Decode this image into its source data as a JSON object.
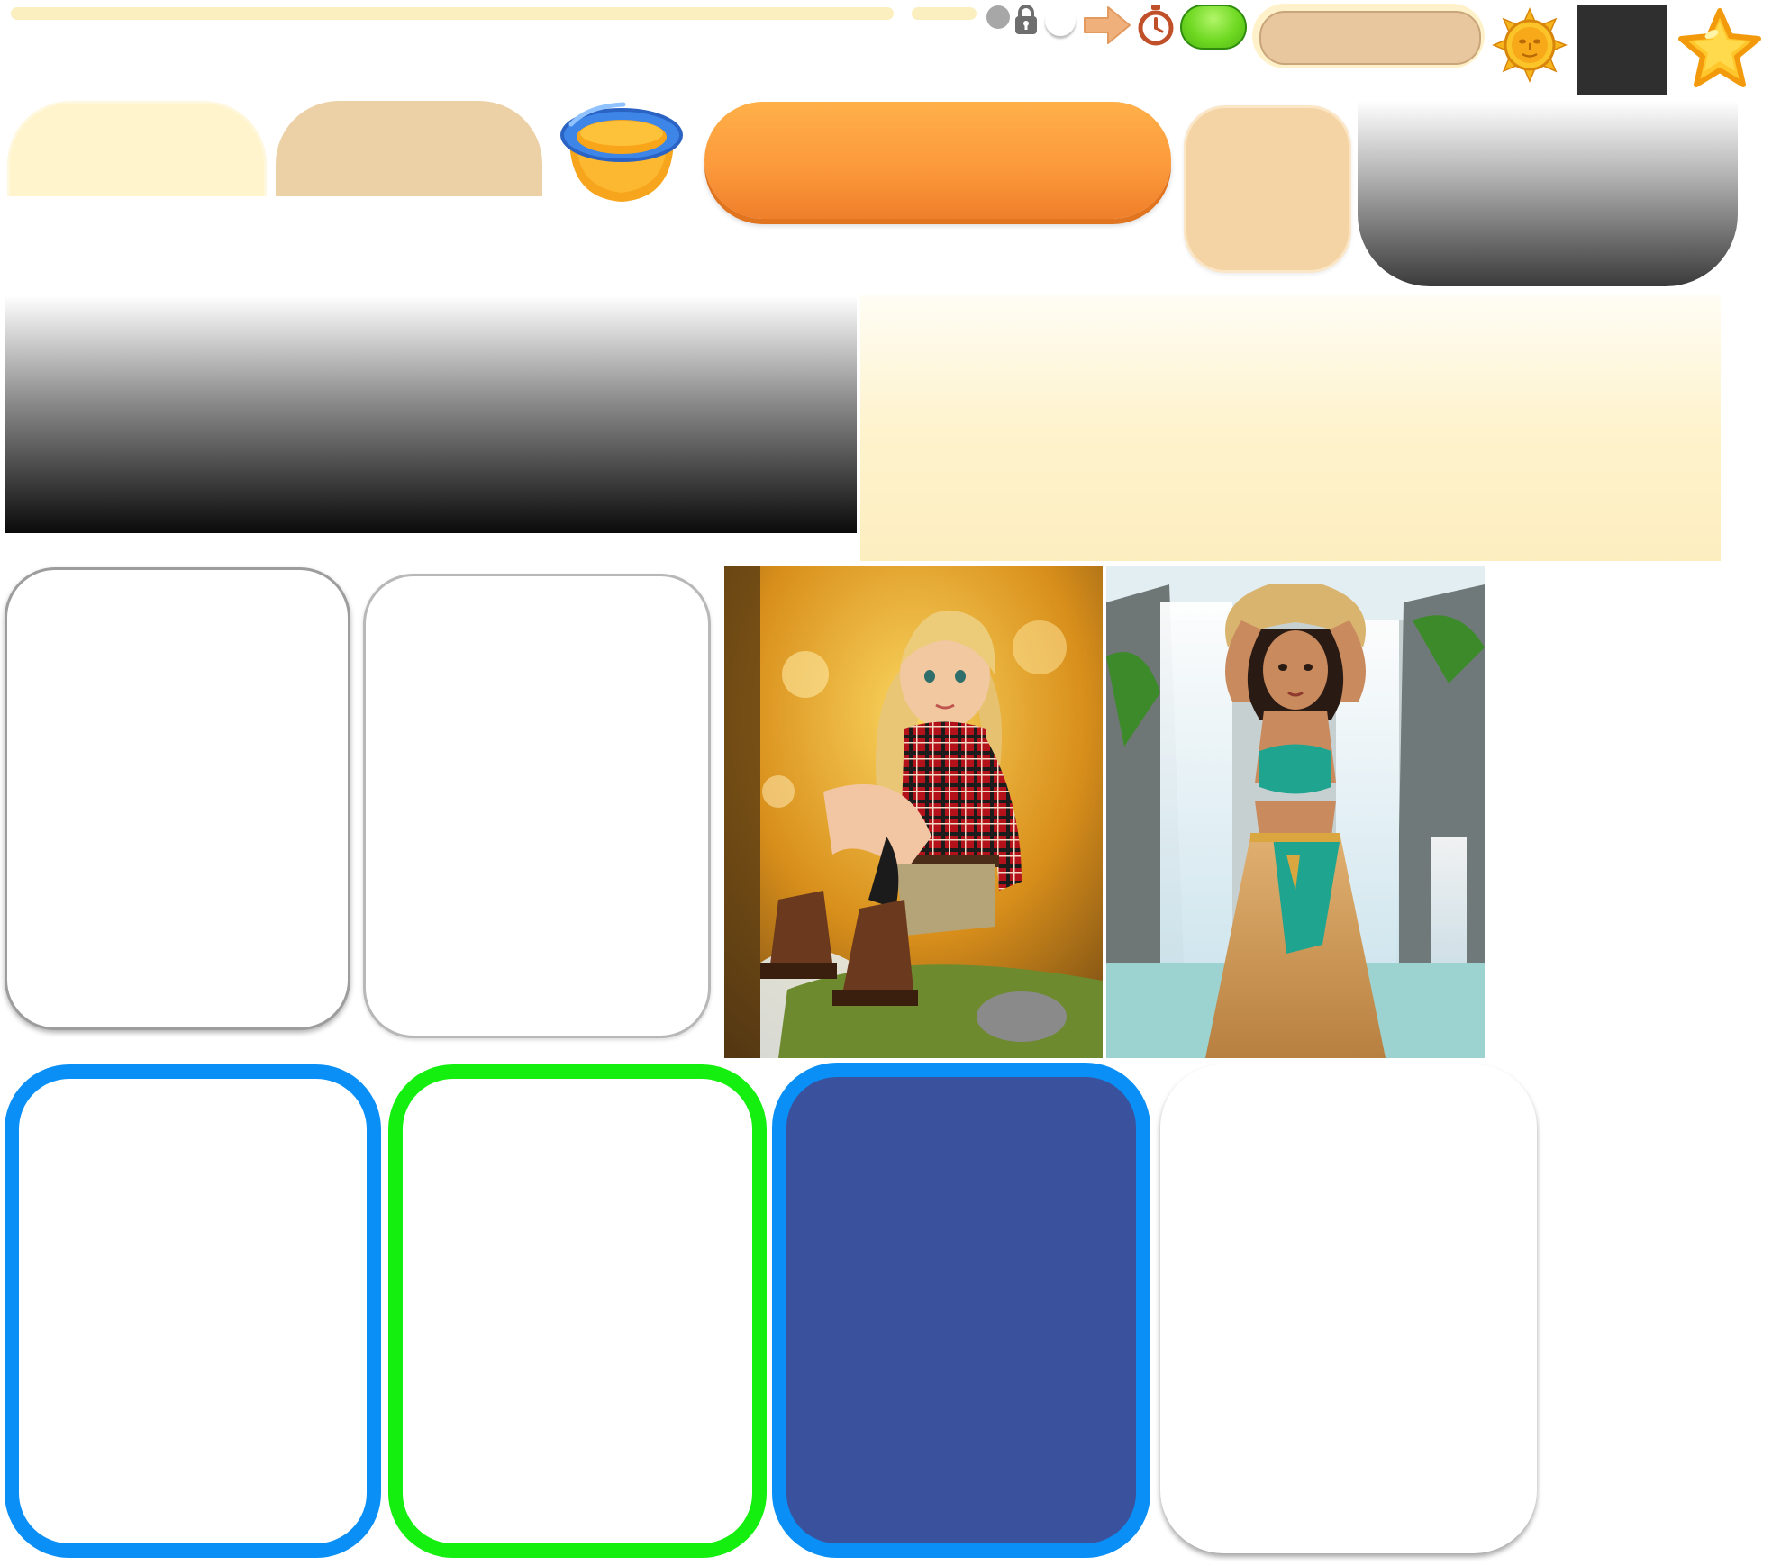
{
  "sprite_sheet": {
    "palette": {
      "cream": "#fff4cb",
      "tan": "#ecd1a7",
      "orange": "#fc9a3c",
      "beige": "#f4d4a4",
      "blue_border": "#0a8ff6",
      "green_border": "#14ef0f",
      "navy_fill": "#3a529d",
      "dark_square": "#2f2f2f",
      "green_pill": "#6fd922",
      "gold": "#f7b51c"
    },
    "icons": [
      "dot-indicator",
      "lock-icon",
      "arrow-right-icon",
      "stopwatch-icon",
      "sun-coin-icon",
      "star-icon",
      "cup-bowl-icon"
    ],
    "portraits": [
      {
        "subject": "woman-in-plaid-shirt-autumn-forest"
      },
      {
        "subject": "woman-at-waterfall-straw-hat"
      }
    ]
  }
}
